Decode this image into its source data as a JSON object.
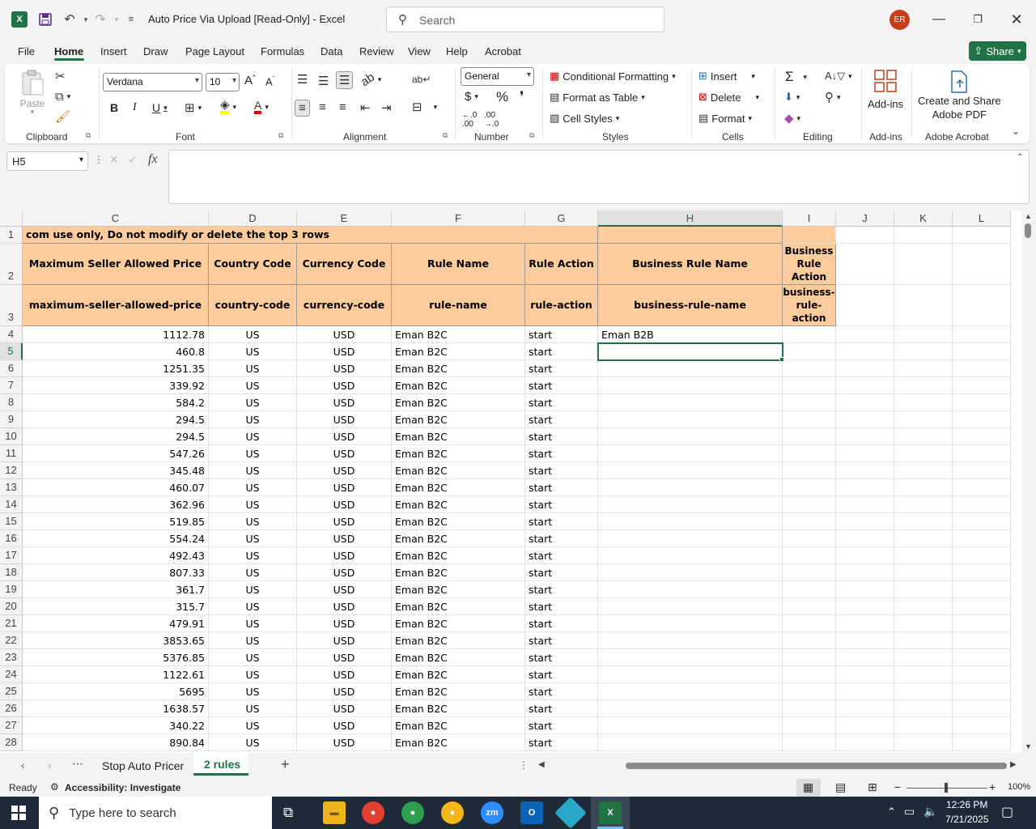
{
  "titlebar": {
    "title": "Auto Price Via Upload  [Read-Only]  -  Excel",
    "search_placeholder": "Search",
    "avatar_initials": "ER"
  },
  "menu": {
    "items": [
      "File",
      "Home",
      "Insert",
      "Draw",
      "Page Layout",
      "Formulas",
      "Data",
      "Review",
      "View",
      "Help",
      "Acrobat"
    ],
    "active": "Home",
    "share_label": "Share"
  },
  "ribbon": {
    "clipboard": {
      "label": "Clipboard",
      "paste": "Paste"
    },
    "font": {
      "label": "Font",
      "family": "Verdana",
      "size": "10"
    },
    "alignment": {
      "label": "Alignment"
    },
    "number": {
      "label": "Number",
      "format": "General"
    },
    "styles": {
      "label": "Styles",
      "conditional": "Conditional Formatting",
      "format_table": "Format as Table",
      "cell_styles": "Cell Styles"
    },
    "cells": {
      "label": "Cells",
      "insert": "Insert",
      "delete": "Delete",
      "format": "Format"
    },
    "editing": {
      "label": "Editing"
    },
    "addins": {
      "label": "Add-ins",
      "button": "Add-ins"
    },
    "acrobat": {
      "label": "Adobe Acrobat",
      "button_line1": "Create and Share",
      "button_line2": "Adobe PDF"
    }
  },
  "formula_bar": {
    "name_box": "H5",
    "value": ""
  },
  "columns": [
    "C",
    "D",
    "E",
    "F",
    "G",
    "H",
    "I",
    "J",
    "K",
    "L"
  ],
  "selected_column": "H",
  "selected_row": "5",
  "header_rows": {
    "row1": "com use only, Do not modify or delete the top 3 rows",
    "row2": [
      "Maximum Seller Allowed Price",
      "Country Code",
      "Currency Code",
      "Rule Name",
      "Rule Action",
      "Business Rule Name",
      "Business Rule Action"
    ],
    "row3": [
      "maximum-seller-allowed-price",
      "country-code",
      "currency-code",
      "rule-name",
      "rule-action",
      "business-rule-name",
      "business-rule-action"
    ]
  },
  "rows": [
    {
      "n": "4",
      "price": "1112.78",
      "country": "US",
      "currency": "USD",
      "rule": "Eman B2C",
      "action": "start",
      "brule": "Eman B2B"
    },
    {
      "n": "5",
      "price": "460.8",
      "country": "US",
      "currency": "USD",
      "rule": "Eman B2C",
      "action": "start",
      "brule": ""
    },
    {
      "n": "6",
      "price": "1251.35",
      "country": "US",
      "currency": "USD",
      "rule": "Eman B2C",
      "action": "start",
      "brule": ""
    },
    {
      "n": "7",
      "price": "339.92",
      "country": "US",
      "currency": "USD",
      "rule": "Eman B2C",
      "action": "start",
      "brule": ""
    },
    {
      "n": "8",
      "price": "584.2",
      "country": "US",
      "currency": "USD",
      "rule": "Eman B2C",
      "action": "start",
      "brule": ""
    },
    {
      "n": "9",
      "price": "294.5",
      "country": "US",
      "currency": "USD",
      "rule": "Eman B2C",
      "action": "start",
      "brule": ""
    },
    {
      "n": "10",
      "price": "294.5",
      "country": "US",
      "currency": "USD",
      "rule": "Eman B2C",
      "action": "start",
      "brule": ""
    },
    {
      "n": "11",
      "price": "547.26",
      "country": "US",
      "currency": "USD",
      "rule": "Eman B2C",
      "action": "start",
      "brule": ""
    },
    {
      "n": "12",
      "price": "345.48",
      "country": "US",
      "currency": "USD",
      "rule": "Eman B2C",
      "action": "start",
      "brule": ""
    },
    {
      "n": "13",
      "price": "460.07",
      "country": "US",
      "currency": "USD",
      "rule": "Eman B2C",
      "action": "start",
      "brule": ""
    },
    {
      "n": "14",
      "price": "362.96",
      "country": "US",
      "currency": "USD",
      "rule": "Eman B2C",
      "action": "start",
      "brule": ""
    },
    {
      "n": "15",
      "price": "519.85",
      "country": "US",
      "currency": "USD",
      "rule": "Eman B2C",
      "action": "start",
      "brule": ""
    },
    {
      "n": "16",
      "price": "554.24",
      "country": "US",
      "currency": "USD",
      "rule": "Eman B2C",
      "action": "start",
      "brule": ""
    },
    {
      "n": "17",
      "price": "492.43",
      "country": "US",
      "currency": "USD",
      "rule": "Eman B2C",
      "action": "start",
      "brule": ""
    },
    {
      "n": "18",
      "price": "807.33",
      "country": "US",
      "currency": "USD",
      "rule": "Eman B2C",
      "action": "start",
      "brule": ""
    },
    {
      "n": "19",
      "price": "361.7",
      "country": "US",
      "currency": "USD",
      "rule": "Eman B2C",
      "action": "start",
      "brule": ""
    },
    {
      "n": "20",
      "price": "315.7",
      "country": "US",
      "currency": "USD",
      "rule": "Eman B2C",
      "action": "start",
      "brule": ""
    },
    {
      "n": "21",
      "price": "479.91",
      "country": "US",
      "currency": "USD",
      "rule": "Eman B2C",
      "action": "start",
      "brule": ""
    },
    {
      "n": "22",
      "price": "3853.65",
      "country": "US",
      "currency": "USD",
      "rule": "Eman B2C",
      "action": "start",
      "brule": ""
    },
    {
      "n": "23",
      "price": "5376.85",
      "country": "US",
      "currency": "USD",
      "rule": "Eman B2C",
      "action": "start",
      "brule": ""
    },
    {
      "n": "24",
      "price": "1122.61",
      "country": "US",
      "currency": "USD",
      "rule": "Eman B2C",
      "action": "start",
      "brule": ""
    },
    {
      "n": "25",
      "price": "5695",
      "country": "US",
      "currency": "USD",
      "rule": "Eman B2C",
      "action": "start",
      "brule": ""
    },
    {
      "n": "26",
      "price": "1638.57",
      "country": "US",
      "currency": "USD",
      "rule": "Eman B2C",
      "action": "start",
      "brule": ""
    },
    {
      "n": "27",
      "price": "340.22",
      "country": "US",
      "currency": "USD",
      "rule": "Eman B2C",
      "action": "start",
      "brule": ""
    },
    {
      "n": "28",
      "price": "890.84",
      "country": "US",
      "currency": "USD",
      "rule": "Eman B2C",
      "action": "start",
      "brule": ""
    }
  ],
  "sheets": {
    "tabs": [
      "Stop Auto Pricer",
      "2 rules"
    ],
    "active": "2 rules"
  },
  "status": {
    "ready": "Ready",
    "accessibility": "Accessibility: Investigate",
    "zoom": "100%"
  },
  "taskbar": {
    "search_placeholder": "Type here to search",
    "time": "12:26 PM",
    "date": "7/21/2025"
  },
  "colors": {
    "excel_green": "#217346",
    "header_fill": "#fdcc9d",
    "taskbar": "#1f2a38"
  }
}
